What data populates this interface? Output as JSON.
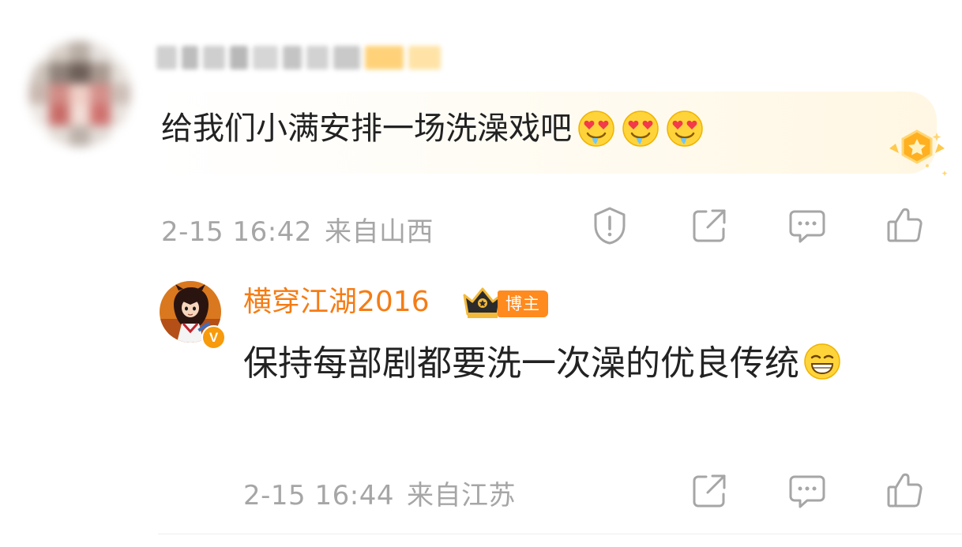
{
  "comment": {
    "text": "给我们小满安排一场洗澡戏吧",
    "emojis": [
      "heart-eyes-emoji",
      "heart-eyes-emoji",
      "heart-eyes-emoji"
    ],
    "time": "2-15 16:42",
    "location": "来自山西",
    "actions": [
      "report-icon",
      "share-icon",
      "comment-icon",
      "like-icon"
    ]
  },
  "reply": {
    "author": "横穿江湖2016",
    "role_tag": "博主",
    "verified_badge": "V",
    "text": "保持每部剧都要洗一次澡的优良传统",
    "emoji": "smirk-grin-emoji",
    "time": "2-15 16:44",
    "location": "来自江苏",
    "actions": [
      "share-icon",
      "comment-icon",
      "like-icon"
    ]
  },
  "colors": {
    "author_name": "#f57c14",
    "role_tag_bg": "#ff8a1e",
    "meta_text": "#a6a6a6",
    "body_text": "#222222"
  }
}
